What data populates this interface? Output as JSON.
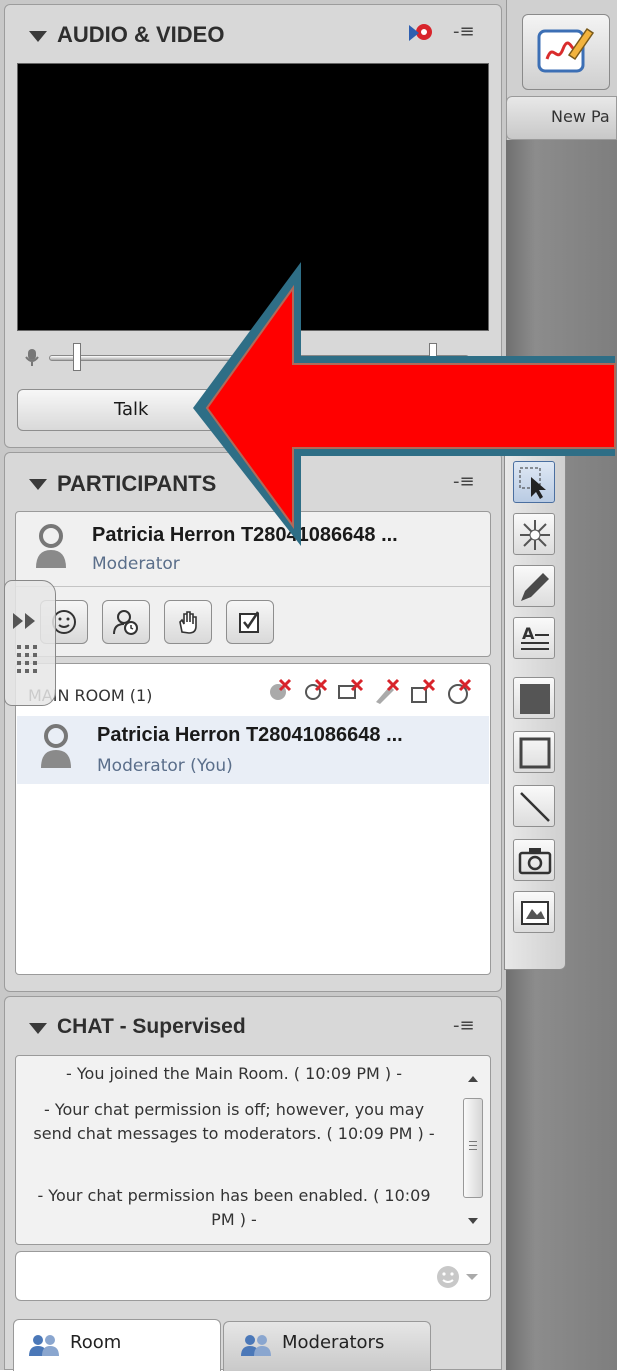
{
  "audio_video": {
    "title": "AUDIO & VIDEO",
    "talk_label": "Talk"
  },
  "whiteboard": {
    "new_page_label": "New Pa"
  },
  "participants": {
    "title": "PARTICIPANTS",
    "self": {
      "name": "Patricia Herron T28041086648 ...",
      "role": "Moderator"
    },
    "main_room_label": "MAIN ROOM (1)",
    "list": [
      {
        "name": "Patricia Herron T28041086648 ...",
        "role": "Moderator (You)"
      }
    ]
  },
  "chat": {
    "title": "CHAT - Supervised",
    "messages": [
      "- You joined the Main Room. ( 10:09 PM ) -",
      "- Your chat permission is off; however, you may send chat messages to moderators. ( 10:09 PM ) -",
      "- Your chat permission has been enabled. ( 10:09 PM ) -"
    ],
    "tabs": [
      "Room",
      "Moderators"
    ]
  },
  "colors": {
    "arrow_fill": "#ff0000",
    "arrow_outline": "#2e6e86",
    "panel_bg": "#d8d8d8",
    "right_bg": "#808080"
  }
}
